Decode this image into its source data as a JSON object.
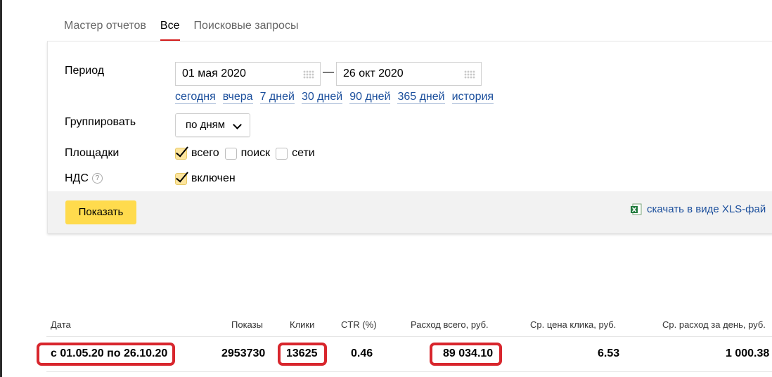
{
  "tabs": [
    {
      "label": "Мастер отчетов"
    },
    {
      "label": "Все"
    },
    {
      "label": "Поисковые запросы"
    }
  ],
  "form": {
    "period_label": "Период",
    "date_from": "01 мая 2020",
    "date_to": "26 окт 2020",
    "date_separator": "—",
    "quick_links": [
      {
        "label": "сегодня"
      },
      {
        "label": "вчера"
      },
      {
        "label": "7 дней"
      },
      {
        "label": "30 дней"
      },
      {
        "label": "90 дней"
      },
      {
        "label": "365 дней"
      },
      {
        "label": "история"
      }
    ],
    "group_label": "Группировать",
    "group_value": "по дням",
    "platforms_label": "Площадки",
    "platforms": [
      {
        "label": "всего",
        "checked": true
      },
      {
        "label": "поиск",
        "checked": false
      },
      {
        "label": "сети",
        "checked": false
      }
    ],
    "vat_label": "НДС",
    "vat_help": "?",
    "vat_option": {
      "label": "включен",
      "checked": true
    },
    "show_button": "Показать",
    "xls_link": "скачать в виде XLS-фай"
  },
  "table": {
    "columns": [
      "Дата",
      "Показы",
      "Клики",
      "CTR (%)",
      "Расход всего, руб.",
      "Ср. цена клика, руб.",
      "Ср. расход за день, руб."
    ],
    "row": [
      "с 01.05.20 по 26.10.20",
      "2953730",
      "13625",
      "0.46",
      "89 034.10",
      "6.53",
      "1 000.38"
    ]
  },
  "colors": {
    "accent_tab": "#d41c1c",
    "button": "#ffdb4d",
    "link": "#1a4e9c",
    "highlight": "#d8262d",
    "checkbox_checked": "#fde59d"
  }
}
